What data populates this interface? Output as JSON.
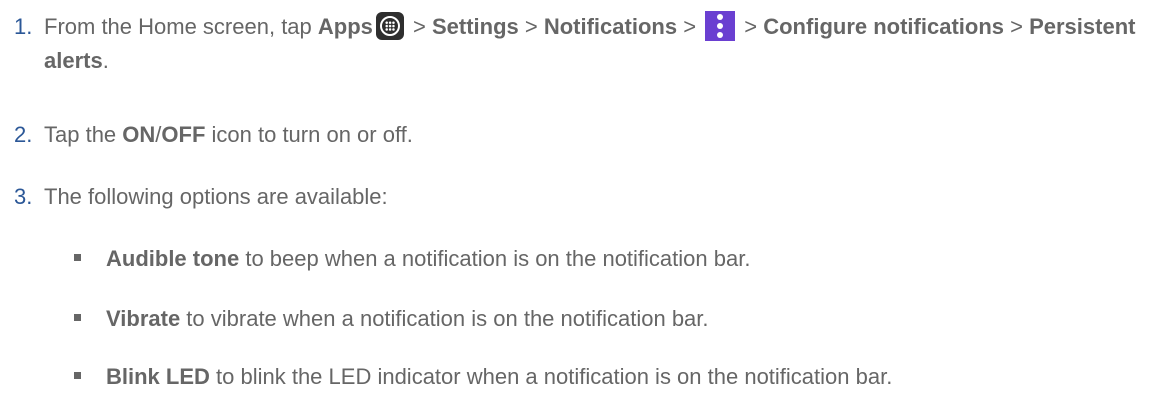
{
  "steps": [
    {
      "num": "1.",
      "t1": "From the Home screen, tap ",
      "b1": "Apps",
      "icon1": "apps-grid-icon",
      "t2": " > ",
      "b2": "Settings",
      "t3": " > ",
      "b3": "Notifications",
      "t4": " > ",
      "icon2": "more-options-icon",
      "t5": " > ",
      "b4": "Configure notifications",
      "t6": " > ",
      "b5": "Persistent alerts",
      "t7": "."
    },
    {
      "num": "2.",
      "t1": "Tap the ",
      "b1": "ON",
      "t2": "/",
      "b2": "OFF",
      "t3": " icon to turn on or off."
    },
    {
      "num": "3.",
      "t1": "The following options are available:"
    }
  ],
  "bullets": [
    {
      "bold": "Audible tone",
      "text": " to beep when a notification is on the notification bar."
    },
    {
      "bold": "Vibrate",
      "text": " to vibrate when a notification is on the notification bar."
    },
    {
      "bold": "Blink LED",
      "text": " to blink the LED indicator when a notification is on the notification bar."
    }
  ],
  "colors": {
    "step_number": "#2b5797",
    "body_text": "#666666",
    "menu_icon_bg": "#6a3fd1",
    "apps_icon_bg": "#2e2e2e"
  }
}
